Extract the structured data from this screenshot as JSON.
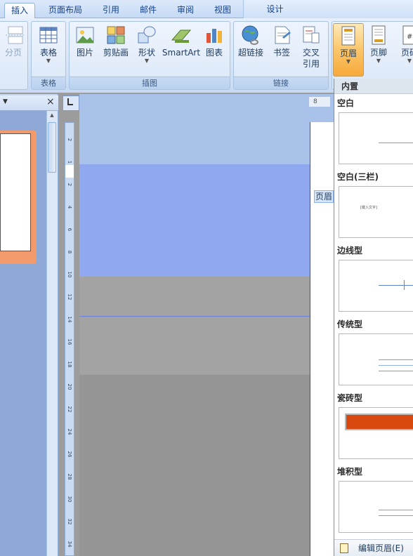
{
  "tabs": [
    {
      "label": "插入",
      "active": true
    },
    {
      "label": "页面布局"
    },
    {
      "label": "引用"
    },
    {
      "label": "邮件"
    },
    {
      "label": "审阅"
    },
    {
      "label": "视图"
    },
    {
      "label": "设计",
      "contextual": true
    }
  ],
  "ribbon": {
    "pages_partial": {
      "label": "分页"
    },
    "table_group": {
      "name": "表格",
      "table": "表格"
    },
    "illustrations_group": {
      "name": "插图",
      "picture": "图片",
      "clipart": "剪贴画",
      "shapes": "形状",
      "smartart": "SmartArt",
      "chart": "图表"
    },
    "links_group": {
      "name": "链接",
      "hyperlink": "超链接",
      "bookmark": "书签",
      "crossref_line1": "交叉",
      "crossref_line2": "引用"
    },
    "hf_group": {
      "header": "页眉",
      "footer": "页脚",
      "pagenum_partial": "页码"
    }
  },
  "document": {
    "header_tag": "页眉",
    "ruler_number": "8",
    "vruler_ticks": [
      "2",
      "1",
      "2",
      "4",
      "6",
      "8",
      "10",
      "12",
      "14",
      "16",
      "18",
      "20",
      "22",
      "24",
      "26",
      "28",
      "30",
      "32",
      "34"
    ]
  },
  "gallery": {
    "section_title": "内置",
    "items": [
      {
        "label": "空白"
      },
      {
        "label": "空白(三栏)",
        "preview_text": "[键入文字]"
      },
      {
        "label": "边线型"
      },
      {
        "label": "传统型"
      },
      {
        "label": "瓷砖型"
      },
      {
        "label": "堆积型"
      }
    ],
    "footer_action": "编辑页眉(E)"
  },
  "colors": {
    "accent_orange": "#f7a93b",
    "tile_orange": "#d9480f"
  }
}
